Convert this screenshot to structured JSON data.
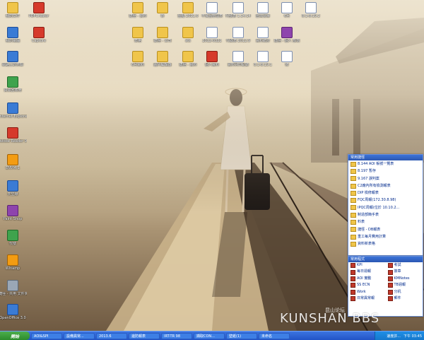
{
  "desktop": {
    "left_icons": [
      {
        "label": "我的文件",
        "icon": "documents-icon",
        "kind": "folder"
      },
      {
        "label": "我的電腦",
        "icon": "computer-icon",
        "kind": "app-blue"
      },
      {
        "label": "網路上的芳鄰",
        "icon": "network-icon",
        "kind": "app-blue"
      },
      {
        "label": "資源回收筒",
        "icon": "recycle-bin-icon",
        "kind": "app-green"
      },
      {
        "label": "Internet Explorer",
        "icon": "internet-explorer-icon",
        "kind": "app-blue"
      },
      {
        "label": "Adobe Reader 9",
        "icon": "adobe-reader-icon",
        "kind": "app-red"
      },
      {
        "label": "ENVI4.1",
        "icon": "envi-icon",
        "kind": "app-orange"
      },
      {
        "label": "天空線",
        "icon": "app-icon",
        "kind": "app-blue"
      },
      {
        "label": "Paint Shop",
        "icon": "paint-icon",
        "kind": "app-purple"
      },
      {
        "label": "代號",
        "icon": "app-icon",
        "kind": "app-green"
      },
      {
        "label": "Winamp",
        "icon": "winamp-icon",
        "kind": "app-orange"
      },
      {
        "label": "捷徑 - 共用 文件夾",
        "icon": "shortcut-icon",
        "kind": "app-gray"
      },
      {
        "label": "OpenOffice 3.0",
        "icon": "openoffice-icon",
        "kind": "app-blue"
      }
    ],
    "second_col_icons": [
      {
        "label": "PDFCreator",
        "icon": "pdfcreator-icon",
        "kind": "app-red"
      },
      {
        "label": "Capture",
        "icon": "capture-icon",
        "kind": "app-red"
      }
    ],
    "grid_icons": [
      {
        "label": "捷徑 - 資料",
        "icon": "folder-icon",
        "kind": "folder"
      },
      {
        "label": "新",
        "icon": "folder-icon",
        "kind": "folder"
      },
      {
        "label": "盤點 2011.6",
        "icon": "folder-icon",
        "kind": "folder"
      },
      {
        "label": "不良品管理表",
        "icon": "document-icon",
        "kind": "doc"
      },
      {
        "label": "代號表 1.14.14",
        "icon": "document-icon",
        "kind": "doc"
      },
      {
        "label": "匯出清單",
        "icon": "document-icon",
        "kind": "doc"
      },
      {
        "label": "6月",
        "icon": "document-icon",
        "kind": "doc"
      },
      {
        "label": "8.1-8.19.2",
        "icon": "document-icon",
        "kind": "doc"
      },
      {
        "label": "表格",
        "icon": "folder-icon",
        "kind": "folder"
      },
      {
        "label": "捷徑 - 公司",
        "icon": "folder-icon",
        "kind": "folder"
      },
      {
        "label": "ats",
        "icon": "folder-icon",
        "kind": "folder"
      },
      {
        "label": "2012-0321",
        "icon": "document-icon",
        "kind": "doc"
      },
      {
        "label": "代碼表 2012.9",
        "icon": "document-icon",
        "kind": "doc"
      },
      {
        "label": "資料統計",
        "icon": "document-icon",
        "kind": "doc"
      },
      {
        "label": "捷徑 - 個人 部落",
        "icon": "document-icon",
        "kind": "app-purple"
      },
      {
        "label": "6月資料",
        "icon": "folder-icon",
        "kind": "folder"
      },
      {
        "label": "圖片編輯器",
        "icon": "folder-icon",
        "kind": "folder"
      },
      {
        "label": "捷徑 - 資料",
        "icon": "folder-icon",
        "kind": "folder"
      },
      {
        "label": "個人資料",
        "icon": "document-icon",
        "kind": "app-red"
      },
      {
        "label": "資料列印紀錄",
        "icon": "document-icon",
        "kind": "doc"
      },
      {
        "label": "8.1-8.19.1",
        "icon": "document-icon",
        "kind": "doc"
      },
      {
        "label": "修",
        "icon": "document-icon",
        "kind": "doc"
      }
    ]
  },
  "panel_top": {
    "title": "常用捷徑",
    "items": [
      "8.144 AOI 帳號一覽表",
      "8.197 暫存",
      "9.167 誤判案",
      "C2廠內所有檢測報表",
      "DIP 檢修報表",
      "FQC周報(172.30.8.98)",
      "IPQC周報(位於 10.10.2...",
      "制造部簡手表",
      "料表",
      "捷徑 - DB報表",
      "重工每月費用計算",
      "資料新表格"
    ]
  },
  "panel_bottom": {
    "title": "常用程式",
    "items": [
      "KPI",
      "考試",
      "每日週報",
      "簽章",
      "AOI 實動",
      "KMNotes",
      "SS ECN",
      "TB週報",
      "Work",
      "分机",
      "日常異常報",
      "郵件",
      "",
      ""
    ]
  },
  "taskbar": {
    "start_label": "開始",
    "tasks": [
      "AOI&SPI",
      "設備異常...",
      "2013.6",
      "邊防報表",
      "IRT-TR 98",
      "擷取CON...",
      "壁紙(1)",
      "未命名"
    ],
    "clock": "下午 03:45",
    "tray_text": "速度許..."
  },
  "watermark": {
    "main": "KUNSHAN BBS",
    "sub": "昆山论坛"
  },
  "colors": {
    "taskbar": "#2253c6",
    "start": "#3f9e3f",
    "panel_title": "#2a56b2"
  }
}
